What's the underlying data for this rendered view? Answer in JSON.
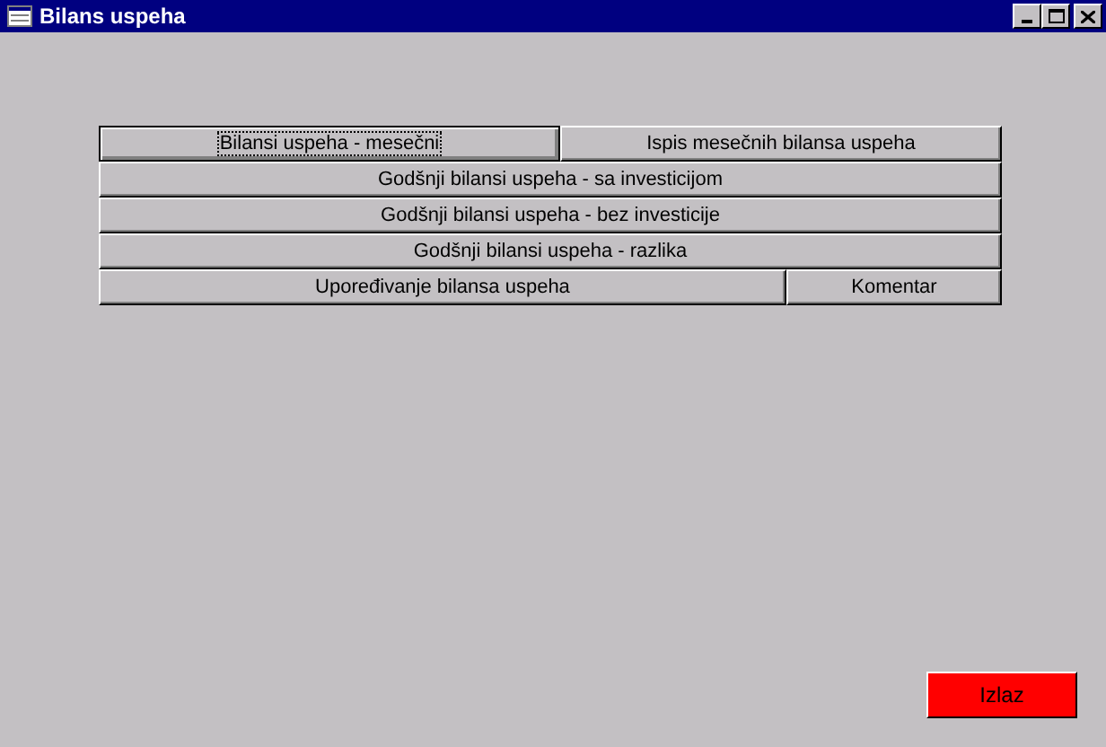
{
  "window": {
    "title": "Bilans uspeha"
  },
  "button_rows": [
    [
      {
        "label": "Bilansi uspeha - mesečni",
        "focused": true
      },
      {
        "label": "Ispis mesečnih bilansa uspeha",
        "focused": false
      }
    ],
    [
      {
        "label": "Godšnji bilansi uspeha - sa investicijom",
        "focused": false
      }
    ],
    [
      {
        "label": "Godšnji bilansi uspeha - bez investicije",
        "focused": false
      }
    ],
    [
      {
        "label": "Godšnji bilansi uspeha - razlika",
        "focused": false
      }
    ],
    [
      {
        "label": "Upoređivanje bilansa uspeha",
        "focused": false
      },
      {
        "label": "Komentar",
        "focused": false
      }
    ]
  ],
  "exit_button": {
    "label": "Izlaz"
  }
}
